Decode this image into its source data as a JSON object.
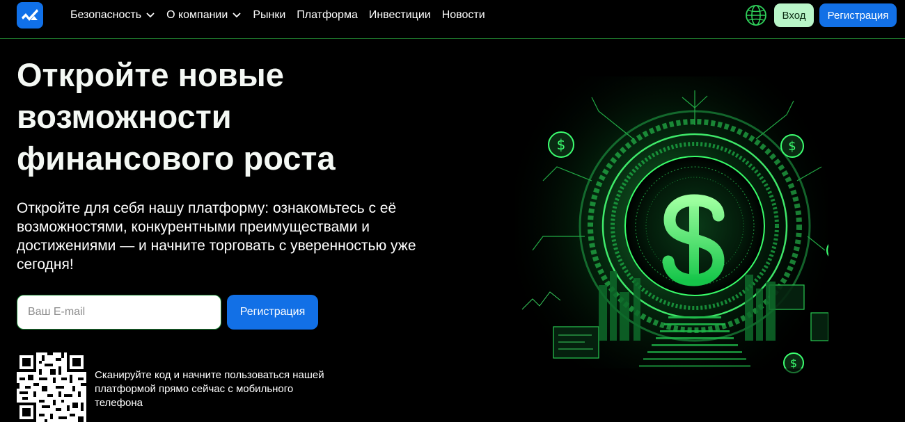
{
  "header": {
    "logo_icon": "brand-logo-icon",
    "nav": [
      {
        "label": "Безопасность",
        "dropdown": true
      },
      {
        "label": "О компании",
        "dropdown": true
      },
      {
        "label": "Рынки",
        "dropdown": false
      },
      {
        "label": "Платформа",
        "dropdown": false
      },
      {
        "label": "Инвестиции",
        "dropdown": false
      },
      {
        "label": "Новости",
        "dropdown": false
      }
    ],
    "globe_icon": "globe-icon",
    "login_label": "Вход",
    "register_label": "Регистрация"
  },
  "hero": {
    "title": "Откройте новые возможности финансового роста",
    "subtitle": "Откройте для себя нашу платформу: ознакомьтесь с её возможностями, конкурентными преимуществами и достижениями — и начните торговать с уверенностью уже сегодня!",
    "email_placeholder": "Ваш E-mail",
    "email_value": "",
    "register_label": "Регистрация",
    "qr_text": "Сканируйте код и начните пользоваться нашей платформой прямо сейчас с мобильного телефона",
    "illustration": "dollar-portal-illustration"
  },
  "colors": {
    "accent_blue": "#1270e6",
    "login_green": "#b9f5c8",
    "header_border": "#1f7a2e",
    "glow_green": "#39ff6a"
  }
}
